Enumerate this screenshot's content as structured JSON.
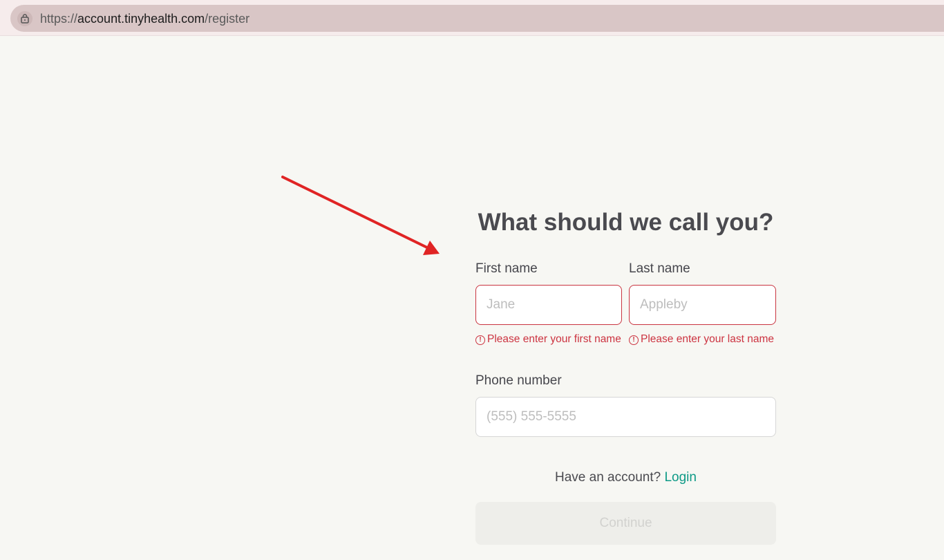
{
  "browser": {
    "url_scheme": "https://",
    "url_host": "account.tinyhealth.com",
    "url_path": "/register"
  },
  "form": {
    "title": "What should we call you?",
    "first_name": {
      "label": "First name",
      "placeholder": "Jane",
      "value": "",
      "error": "Please enter your first name"
    },
    "last_name": {
      "label": "Last name",
      "placeholder": "Appleby",
      "value": "",
      "error": "Please enter your last name"
    },
    "phone": {
      "label": "Phone number",
      "placeholder": "(555) 555-5555",
      "value": ""
    },
    "account_prompt": "Have an account?",
    "login_label": "Login",
    "continue_label": "Continue"
  },
  "colors": {
    "accent": "#0d9a86",
    "error": "#cc3340",
    "annotation_arrow": "#e02424"
  },
  "icons": {
    "lock": "lock-icon",
    "error": "error-circle-icon",
    "annotation": "red-arrow-icon"
  }
}
